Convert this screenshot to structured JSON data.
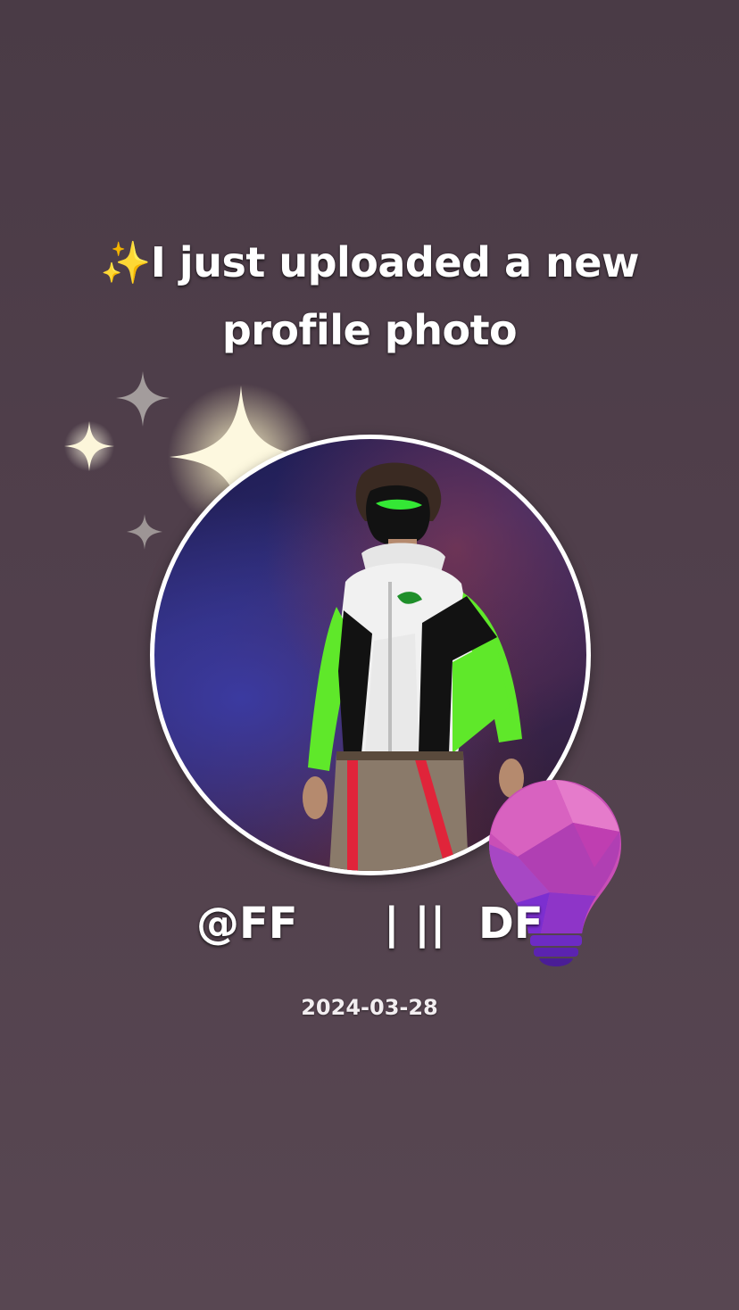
{
  "headline": {
    "emoji": "✨",
    "line1": "I just uploaded a new",
    "line2": "profile photo"
  },
  "profile": {
    "handle_part1": "@FF",
    "separator": "| ||",
    "handle_part2": "DF",
    "date": "2024-03-28"
  },
  "icons": {
    "sparkles": "sparkles-icon",
    "bulb": "lightbulb-icon"
  },
  "colors": {
    "background": "#4f3f4a",
    "jacket_green": "#5fe82a",
    "bulb_pink": "#d24fb4",
    "bulb_purple": "#7a2fd0",
    "sparkle_glow": "#fbf6d6"
  }
}
